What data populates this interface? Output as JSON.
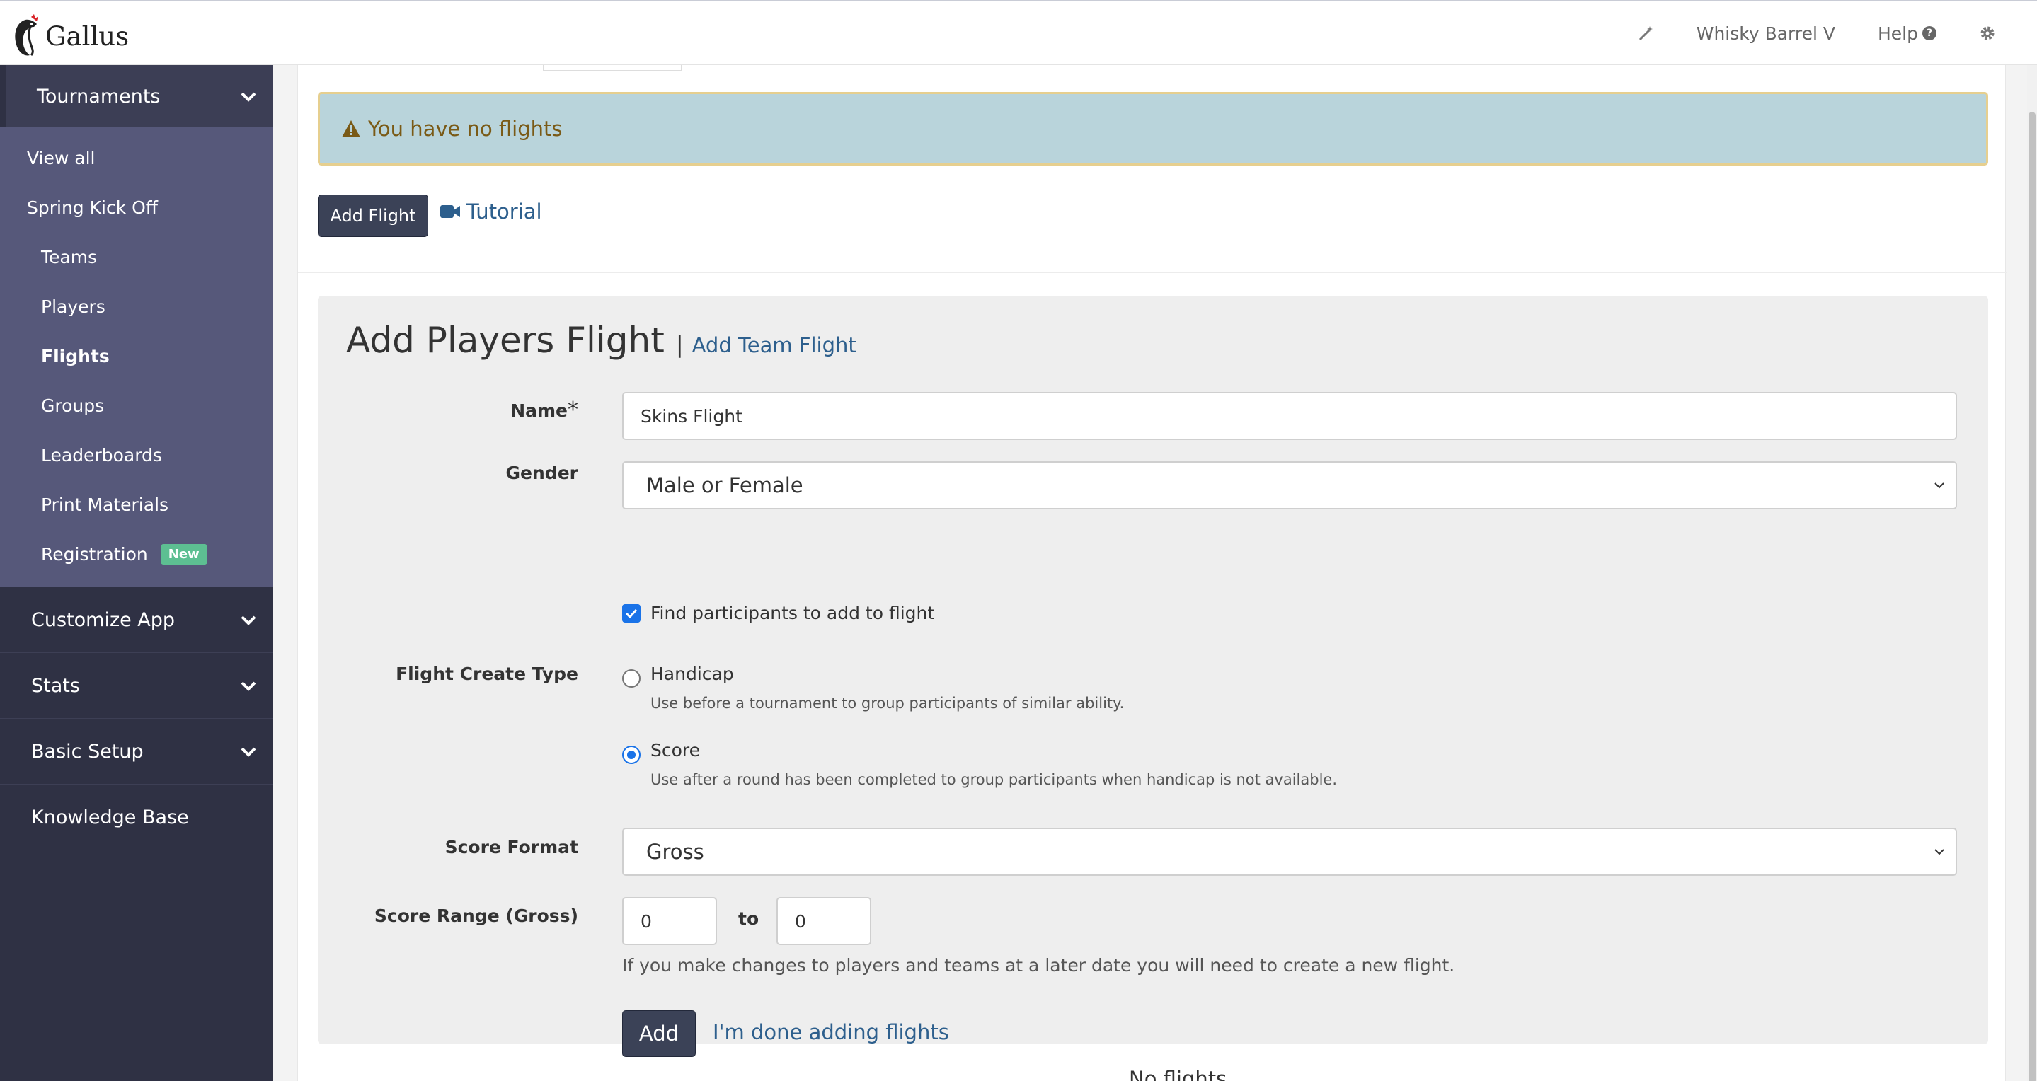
{
  "brand": {
    "name": "Gallus"
  },
  "topbar": {
    "account": "Whisky Barrel V",
    "help": "Help",
    "help_glyph": "?",
    "icons": [
      "magic-wand-icon",
      "question-circle-icon",
      "gear-icon"
    ]
  },
  "sidebar": {
    "section_open": "Tournaments",
    "items": [
      {
        "label": "View all"
      },
      {
        "label": "Spring Kick Off"
      },
      {
        "label": "Teams"
      },
      {
        "label": "Players"
      },
      {
        "label": "Flights",
        "active": true
      },
      {
        "label": "Groups"
      },
      {
        "label": "Leaderboards"
      },
      {
        "label": "Print Materials"
      },
      {
        "label": "Registration",
        "badge": "New"
      }
    ],
    "sections": [
      {
        "label": "Customize App"
      },
      {
        "label": "Stats"
      },
      {
        "label": "Basic Setup"
      },
      {
        "label": "Knowledge Base"
      }
    ]
  },
  "alert": {
    "text": "You have no flights",
    "icon": "warning-triangle-icon"
  },
  "actions": {
    "add_flight": "Add Flight",
    "tutorial": "Tutorial"
  },
  "form": {
    "title": "Add Players Flight",
    "separator": "|",
    "alt_link": "Add Team Flight",
    "name_label": "Name",
    "required_mark": "*",
    "name_value": "Skins Flight",
    "gender_label": "Gender",
    "gender_value": "Male or Female",
    "find_label": "Find participants to add to flight",
    "find_checked": true,
    "create_type_label": "Flight Create Type",
    "handicap_label": "Handicap",
    "handicap_help": "Use before a tournament to group participants of similar ability.",
    "score_label": "Score",
    "score_help": "Use after a round has been completed to group participants when handicap is not available.",
    "selected_type": "Score",
    "score_format_label": "Score Format",
    "score_format_value": "Gross",
    "score_range_label": "Score Range (Gross)",
    "range_from": "0",
    "range_to_label": "to",
    "range_to": "0",
    "note": "If you make changes to players and teams at a later date you will need to create a new flight.",
    "add_button": "Add",
    "done_link": "I'm done adding flights"
  },
  "footer_partial": "No flights"
}
